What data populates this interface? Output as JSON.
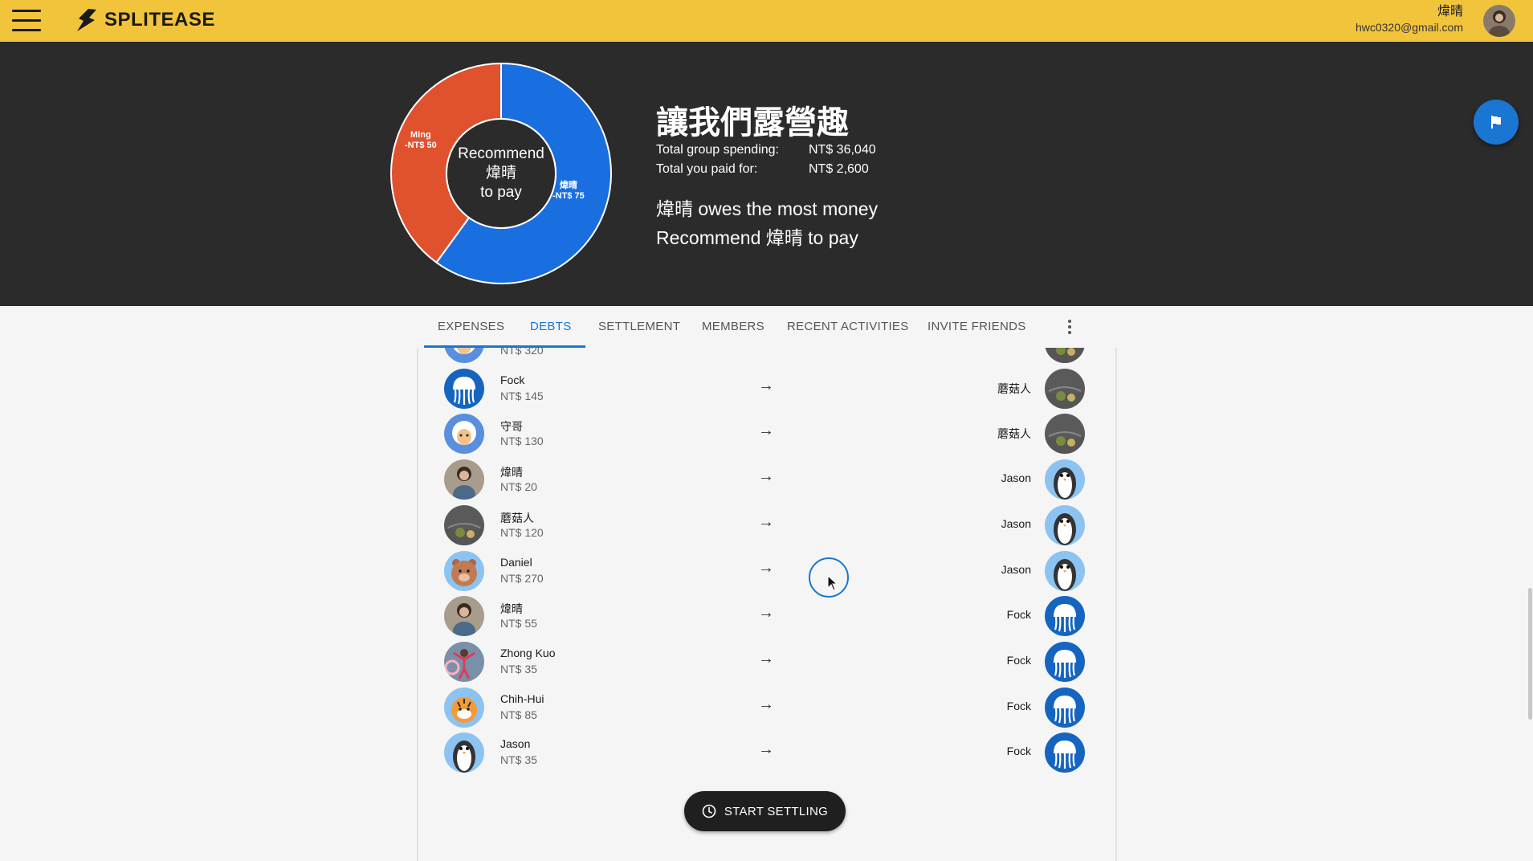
{
  "app": {
    "name": "SPLITEASE"
  },
  "user": {
    "name": "煒晴",
    "email": "hwc0320@gmail.com"
  },
  "group": {
    "title": "讓我們露營趣",
    "stats": [
      {
        "label": "Total group spending:",
        "value": "NT$ 36,040"
      },
      {
        "label": "Total you paid for:",
        "value": "NT$ 2,600"
      }
    ],
    "message_line1": "煒晴 owes the most money",
    "message_line2": "Recommend 煒晴 to pay"
  },
  "chart_data": {
    "type": "pie",
    "center_text": [
      "Recommend",
      "煒晴",
      "to pay"
    ],
    "slices": [
      {
        "name": "煒晴",
        "label": "-NT$ 75",
        "value": 75,
        "color": "#1a6fe0"
      },
      {
        "name": "Ming",
        "label": "-NT$ 50",
        "value": 50,
        "color": "#e0512e"
      }
    ]
  },
  "tabs": [
    {
      "label": "EXPENSES",
      "active": false
    },
    {
      "label": "DEBTS",
      "active": true
    },
    {
      "label": "SETTLEMENT",
      "active": false
    },
    {
      "label": "MEMBERS",
      "active": false
    },
    {
      "label": "RECENT ACTIVITIES",
      "active": false
    },
    {
      "label": "INVITE FRIENDS",
      "active": false
    }
  ],
  "debts": [
    {
      "from": "",
      "amount": "NT$ 320",
      "to": "",
      "from_avatar": "sheep",
      "to_avatar": "mushroom"
    },
    {
      "from": "Fock",
      "amount": "NT$ 145",
      "to": "蘑菇人",
      "from_avatar": "jellyfish",
      "to_avatar": "mushroom"
    },
    {
      "from": "守哥",
      "amount": "NT$ 130",
      "to": "蘑菇人",
      "from_avatar": "sheep",
      "to_avatar": "mushroom"
    },
    {
      "from": "煒晴",
      "amount": "NT$ 20",
      "to": "Jason",
      "from_avatar": "photo",
      "to_avatar": "penguin"
    },
    {
      "from": "蘑菇人",
      "amount": "NT$ 120",
      "to": "Jason",
      "from_avatar": "mushroom",
      "to_avatar": "penguin"
    },
    {
      "from": "Daniel",
      "amount": "NT$ 270",
      "to": "Jason",
      "from_avatar": "bear",
      "to_avatar": "penguin"
    },
    {
      "from": "煒晴",
      "amount": "NT$ 55",
      "to": "Fock",
      "from_avatar": "photo",
      "to_avatar": "jellyfish"
    },
    {
      "from": "Zhong Kuo",
      "amount": "NT$ 35",
      "to": "Fock",
      "from_avatar": "dancer",
      "to_avatar": "jellyfish"
    },
    {
      "from": "Chih-Hui",
      "amount": "NT$ 85",
      "to": "Fock",
      "from_avatar": "tiger",
      "to_avatar": "jellyfish"
    },
    {
      "from": "Jason",
      "amount": "NT$ 35",
      "to": "Fock",
      "from_avatar": "penguin",
      "to_avatar": "jellyfish"
    }
  ],
  "arrow": "→",
  "actions": {
    "start_settling": "START SETTLING"
  },
  "icons": {
    "menu": "hamburger-icon",
    "flag": "flag-icon",
    "more": "more-vert-icon",
    "clock": "clock-icon"
  }
}
